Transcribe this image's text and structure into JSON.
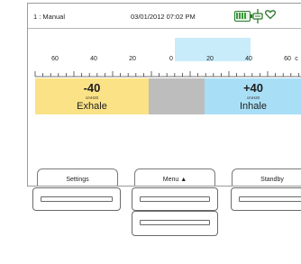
{
  "status": {
    "mode": "1 : Manual",
    "datetime": "03/01/2012 07:02 PM",
    "icons": [
      "battery-icon",
      "plug-icon",
      "heart-icon"
    ],
    "battery_color": "#2d7a2d",
    "heart_color": "#2d7a2d"
  },
  "scale": {
    "labels": [
      "60",
      "40",
      "20",
      "0",
      "20",
      "40",
      "60",
      "c"
    ]
  },
  "pressure_bar": {
    "exhale": {
      "value": "-40",
      "unit": "cmH20",
      "label": "Exhale",
      "color": "#fbe286"
    },
    "neutral_color": "#bdbdbd",
    "inhale": {
      "value": "+40",
      "unit": "cmH20",
      "label": "Inhale",
      "color": "#a9dff6"
    },
    "indicator_color": "#c9ecfa"
  },
  "softkeys": {
    "settings": "Settings",
    "menu": "Menu ▲",
    "standby": "Standby"
  },
  "hardware_buttons": [
    "left-button",
    "center-top-button",
    "right-button",
    "center-bottom-button"
  ]
}
